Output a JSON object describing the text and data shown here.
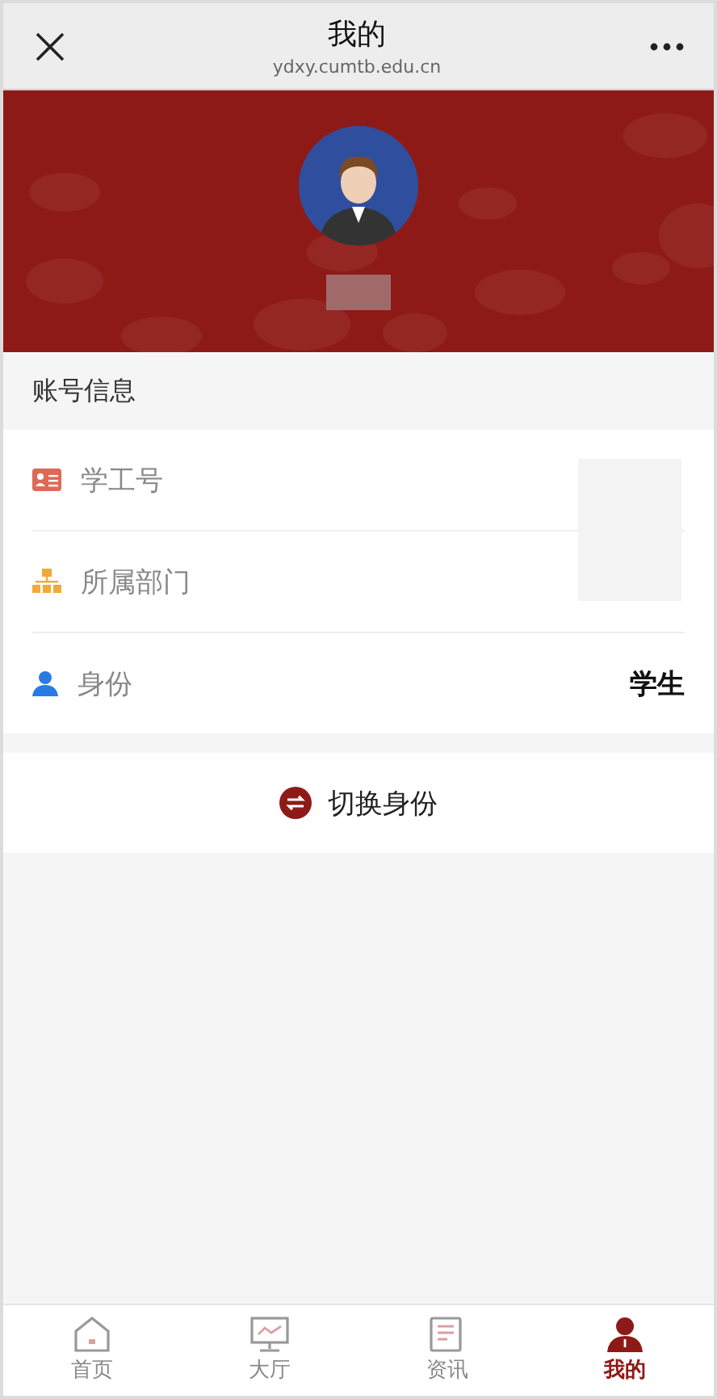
{
  "header": {
    "title": "我的",
    "url": "ydxy.cumtb.edu.cn"
  },
  "section_title": "账号信息",
  "fields": [
    {
      "kind": "id",
      "label": "学工号",
      "redacted": true
    },
    {
      "kind": "department",
      "label": "所属部门",
      "redacted": true
    },
    {
      "kind": "role",
      "label": "身份",
      "value": "学生"
    }
  ],
  "switch_button": {
    "label": "切换身份"
  },
  "tabs": [
    {
      "kind": "home",
      "label": "首页",
      "selected": false
    },
    {
      "kind": "hall",
      "label": "大厅",
      "selected": false
    },
    {
      "kind": "news",
      "label": "资讯",
      "selected": false
    },
    {
      "kind": "me",
      "label": "我的",
      "selected": true
    }
  ]
}
